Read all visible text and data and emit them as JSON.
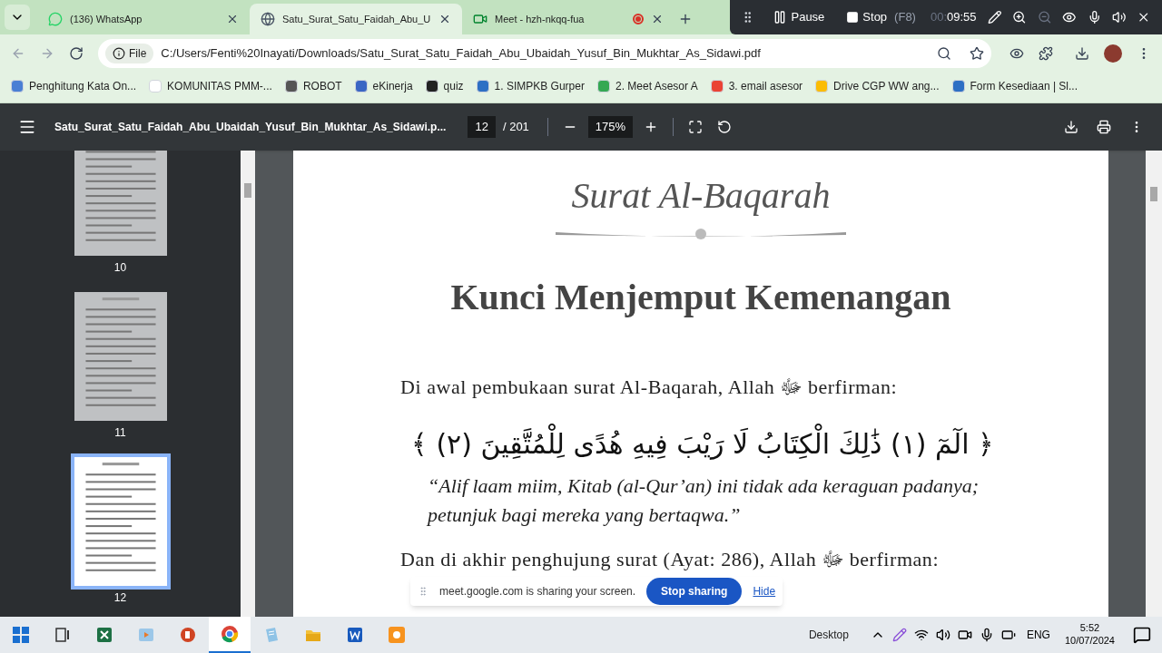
{
  "browser_tabs": [
    {
      "kind": "whatsapp",
      "title": "(136) WhatsApp",
      "selected": false,
      "recording": false
    },
    {
      "kind": "globe",
      "title": "Satu_Surat_Satu_Faidah_Abu_U",
      "selected": true,
      "recording": false
    },
    {
      "kind": "meet",
      "title": "Meet - hzh-nkqq-fua",
      "selected": false,
      "recording": true
    }
  ],
  "recorder": {
    "pause": "Pause",
    "stop": "Stop",
    "shortcut": "(F8)",
    "time_prefix": "00:",
    "time": "09:55"
  },
  "address": {
    "scheme": "File",
    "url": "C:/Users/Fenti%20Inayati/Downloads/Satu_Surat_Satu_Faidah_Abu_Ubaidah_Yusuf_Bin_Mukhtar_As_Sidawi.pdf"
  },
  "bookmarks": [
    {
      "title": "Penghitung Kata On...",
      "color": "#4a7fd4"
    },
    {
      "title": "KOMUNITAS PMM-...",
      "color": "#ffffff"
    },
    {
      "title": "ROBOT",
      "color": "#555555"
    },
    {
      "title": "eKinerja",
      "color": "#3a66c4"
    },
    {
      "title": "quiz",
      "color": "#222222"
    },
    {
      "title": "1. SIMPKB Gurper",
      "color": "#2d6fc4"
    },
    {
      "title": "2. Meet Asesor A",
      "color": "#34a853"
    },
    {
      "title": "3. email asesor",
      "color": "#ea4335"
    },
    {
      "title": "Drive CGP WW ang...",
      "color": "#fbbc04"
    },
    {
      "title": "Form Kesediaan | Sl...",
      "color": "#2d6fc4"
    }
  ],
  "pdf": {
    "file_name": "Satu_Surat_Satu_Faidah_Abu_Ubaidah_Yusuf_Bin_Mukhtar_As_Sidawi.p...",
    "page": "12",
    "total": "/ 201",
    "zoom": "175%"
  },
  "thumbnails": [
    {
      "label": "10",
      "selected": false
    },
    {
      "label": "11",
      "selected": false
    },
    {
      "label": "12",
      "selected": true
    }
  ],
  "document": {
    "surah_title": "Surat Al-Baqarah",
    "heading": "Kunci Menjemput Kemenangan",
    "intro": "Di awal pembukaan surat Al-Baqarah, Allah ﷻ berfirman:",
    "verse": "﴿ الٓمٓ (١) ذَٰلِكَ الْكِتَابُ لَا رَيْبَ فِيهِ هُدًى لِلْمُتَّقِينَ (٢) ﴾",
    "translation": "“Alif laam miim, Kitab (al-Qur’an) ini tidak ada keraguan padanya; petunjuk bagi mereka yang bertaqwa.”",
    "closing": "Dan di akhir penghujung surat (Ayat: 286), Allah ﷻ berfirman:"
  },
  "share_bar": {
    "message": "meet.google.com is sharing your screen.",
    "stop": "Stop sharing",
    "hide": "Hide"
  },
  "taskbar": {
    "apps": [
      {
        "kind": "start",
        "selected": false
      },
      {
        "kind": "taskview",
        "selected": false
      },
      {
        "kind": "excel",
        "selected": false
      },
      {
        "kind": "media",
        "selected": false
      },
      {
        "kind": "powerpoint",
        "selected": false
      },
      {
        "kind": "chrome",
        "selected": true
      },
      {
        "kind": "notepad",
        "selected": false
      },
      {
        "kind": "explorer",
        "selected": false
      },
      {
        "kind": "word",
        "selected": false
      },
      {
        "kind": "recorder",
        "selected": false
      }
    ],
    "desktop": "Desktop",
    "language": "ENG",
    "time": "5:52",
    "date": "10/07/2024"
  }
}
